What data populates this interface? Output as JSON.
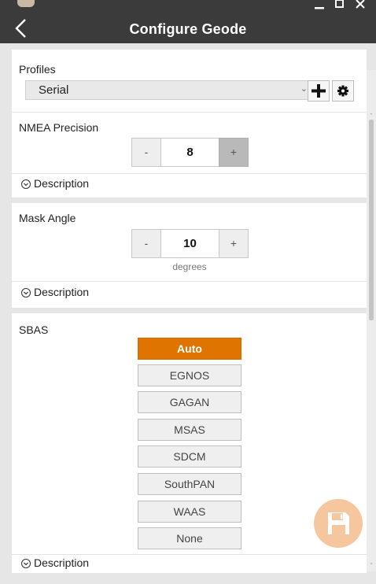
{
  "window": {
    "title": "Configure Geode",
    "icons": {
      "back": "chevron-left-icon",
      "minimize": "minimize-icon",
      "maximize": "maximize-icon",
      "close": "close-icon"
    }
  },
  "profiles": {
    "label": "Profiles",
    "selected": "Serial",
    "add_icon": "plus-icon",
    "settings_icon": "gear-icon"
  },
  "nmea_precision": {
    "label": "NMEA Precision",
    "minus": "-",
    "value": "8",
    "plus": "+",
    "description": "Description"
  },
  "mask_angle": {
    "label": "Mask Angle",
    "minus": "-",
    "value": "10",
    "plus": "+",
    "unit": "degrees",
    "description": "Description"
  },
  "sbas": {
    "label": "SBAS",
    "selected": "Auto",
    "options": [
      "Auto",
      "EGNOS",
      "GAGAN",
      "MSAS",
      "SDCM",
      "SouthPAN",
      "WAAS",
      "None"
    ],
    "description": "Description"
  },
  "save_fab": {
    "icon": "floppy-disk-icon"
  },
  "colors": {
    "titlebar": "#3b3b3b",
    "accent": "#e07400",
    "fab": "#f6c79e",
    "background": "#e6e6e6"
  }
}
